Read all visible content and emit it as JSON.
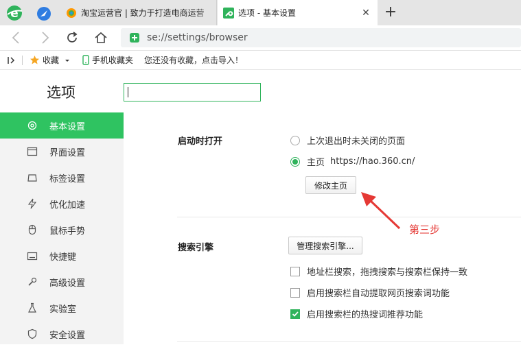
{
  "tabs": [
    {
      "title": "淘宝运营官 | 致力于打造电商运营",
      "favicon": "taobao-favicon",
      "close_label": ""
    },
    {
      "title": "选项 - 基本设置",
      "favicon": "wrench-favicon",
      "close_label": "✕"
    }
  ],
  "new_tab_label": "+",
  "address": {
    "url": "se://settings/browser"
  },
  "bookmarks": {
    "favorites_label": "收藏",
    "mobile_label": "手机收藏夹",
    "hint": "您还没有收藏，点击导入！"
  },
  "page": {
    "title": "选项",
    "search_value": ""
  },
  "sidebar": {
    "items": [
      {
        "label": "基本设置",
        "icon": "gear-icon",
        "active": true
      },
      {
        "label": "界面设置",
        "icon": "window-icon",
        "active": false
      },
      {
        "label": "标签设置",
        "icon": "tab-icon",
        "active": false
      },
      {
        "label": "优化加速",
        "icon": "lightning-icon",
        "active": false
      },
      {
        "label": "鼠标手势",
        "icon": "mouse-icon",
        "active": false
      },
      {
        "label": "快捷键",
        "icon": "keyboard-icon",
        "active": false
      },
      {
        "label": "高级设置",
        "icon": "wrench-icon",
        "active": false
      },
      {
        "label": "实验室",
        "icon": "flask-icon",
        "active": false
      },
      {
        "label": "安全设置",
        "icon": "shield-icon",
        "active": false
      }
    ]
  },
  "startup": {
    "label": "启动时打开",
    "option_restore": "上次退出时未关闭的页面",
    "option_homepage": "主页",
    "homepage_url": "https://hao.360.cn/",
    "selected": "homepage",
    "modify_button": "修改主页"
  },
  "search_engine": {
    "label": "搜索引擎",
    "manage_button": "管理搜索引擎...",
    "options": [
      {
        "label": "地址栏搜索，拖拽搜索与搜索栏保持一致",
        "checked": false
      },
      {
        "label": "启用搜索栏自动提取网页搜索词功能",
        "checked": false
      },
      {
        "label": "启用搜索栏的热搜词推荐功能",
        "checked": true
      }
    ]
  },
  "annotation": {
    "text": "第三步",
    "color": "#e53935"
  },
  "colors": {
    "accent": "#2fc361",
    "brand": "#2fb35b"
  }
}
